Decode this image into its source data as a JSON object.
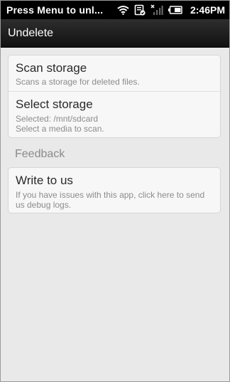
{
  "status_bar": {
    "notification_text": "Press Menu to unl...",
    "time": "2:46PM",
    "icons": [
      "wifi-icon",
      "sync-icon",
      "no-signal-icon",
      "battery-icon"
    ]
  },
  "action_bar": {
    "title": "Undelete"
  },
  "main": {
    "card1": {
      "scan": {
        "title": "Scan storage",
        "summary": "Scans a storage for deleted files."
      },
      "select": {
        "title": "Select storage",
        "selected": "Selected: /mnt/sdcard",
        "summary": "Select a media to scan."
      }
    },
    "feedback_header": "Feedback",
    "card2": {
      "write": {
        "title": "Write to us",
        "summary": "If you have issues with this app, click here to send us debug logs."
      }
    }
  },
  "colors": {
    "status_bar_bg": "#000000",
    "action_bar_bg": "#1e1e1e",
    "content_bg": "#e9e9e9",
    "card_bg": "#f7f7f7",
    "title_text": "#2a2a2a",
    "summary_text": "#8c8c8c"
  }
}
